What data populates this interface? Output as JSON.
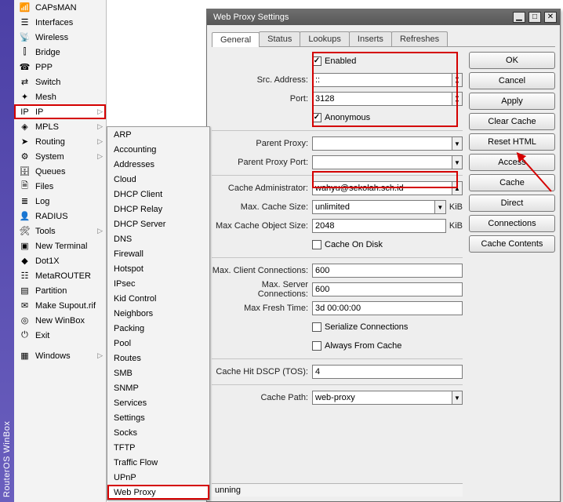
{
  "app": {
    "title": "RouterOS WinBox"
  },
  "nav": {
    "items": [
      {
        "label": "CAPsMAN",
        "icon": "ap-icon"
      },
      {
        "label": "Interfaces",
        "icon": "interfaces-icon"
      },
      {
        "label": "Wireless",
        "icon": "wireless-icon"
      },
      {
        "label": "Bridge",
        "icon": "bridge-icon"
      },
      {
        "label": "PPP",
        "icon": "ppp-icon"
      },
      {
        "label": "Switch",
        "icon": "switch-icon"
      },
      {
        "label": "Mesh",
        "icon": "mesh-icon"
      },
      {
        "label": "IP",
        "icon": "ip-icon",
        "arrow": true,
        "highlight": true
      },
      {
        "label": "MPLS",
        "icon": "mpls-icon",
        "arrow": true
      },
      {
        "label": "Routing",
        "icon": "routing-icon",
        "arrow": true
      },
      {
        "label": "System",
        "icon": "system-icon",
        "arrow": true
      },
      {
        "label": "Queues",
        "icon": "queues-icon"
      },
      {
        "label": "Files",
        "icon": "files-icon"
      },
      {
        "label": "Log",
        "icon": "log-icon"
      },
      {
        "label": "RADIUS",
        "icon": "radius-icon"
      },
      {
        "label": "Tools",
        "icon": "tools-icon",
        "arrow": true
      },
      {
        "label": "New Terminal",
        "icon": "terminal-icon"
      },
      {
        "label": "Dot1X",
        "icon": "dot1x-icon"
      },
      {
        "label": "MetaROUTER",
        "icon": "metarouter-icon"
      },
      {
        "label": "Partition",
        "icon": "partition-icon"
      },
      {
        "label": "Make Supout.rif",
        "icon": "supout-icon"
      },
      {
        "label": "New WinBox",
        "icon": "winbox-icon"
      },
      {
        "label": "Exit",
        "icon": "exit-icon"
      }
    ],
    "windows_label": "Windows"
  },
  "submenu": {
    "items": [
      "ARP",
      "Accounting",
      "Addresses",
      "Cloud",
      "DHCP Client",
      "DHCP Relay",
      "DHCP Server",
      "DNS",
      "Firewall",
      "Hotspot",
      "IPsec",
      "Kid Control",
      "Neighbors",
      "Packing",
      "Pool",
      "Routes",
      "SMB",
      "SNMP",
      "Services",
      "Settings",
      "Socks",
      "TFTP",
      "Traffic Flow",
      "UPnP",
      "Web Proxy"
    ],
    "highlight_index": 24
  },
  "dialog": {
    "title": "Web Proxy Settings",
    "tabs": [
      "General",
      "Status",
      "Lookups",
      "Inserts",
      "Refreshes"
    ],
    "active_tab": 0,
    "buttons": [
      "OK",
      "Cancel",
      "Apply",
      "Clear Cache",
      "Reset HTML",
      "Access",
      "Cache",
      "Direct",
      "Connections",
      "Cache Contents"
    ],
    "form": {
      "enabled_label": "Enabled",
      "enabled": true,
      "src_address_label": "Src. Address:",
      "src_address": "::",
      "port_label": "Port:",
      "port": "3128",
      "anonymous_label": "Anonymous",
      "anonymous": true,
      "parent_proxy_label": "Parent Proxy:",
      "parent_proxy": "",
      "parent_proxy_port_label": "Parent Proxy Port:",
      "parent_proxy_port": "",
      "cache_admin_label": "Cache Administrator:",
      "cache_admin": "wahyu@sekolah.sch.id",
      "max_cache_size_label": "Max. Cache Size:",
      "max_cache_size": "unlimited",
      "max_cache_size_unit": "KiB",
      "max_cache_obj_label": "Max Cache Object Size:",
      "max_cache_obj": "2048",
      "max_cache_obj_unit": "KiB",
      "cache_on_disk_label": "Cache On Disk",
      "cache_on_disk": false,
      "max_client_conn_label": "Max. Client Connections:",
      "max_client_conn": "600",
      "max_server_conn_label": "Max. Server Connections:",
      "max_server_conn": "600",
      "max_fresh_time_label": "Max Fresh Time:",
      "max_fresh_time": "3d 00:00:00",
      "serialize_label": "Serialize Connections",
      "serialize": false,
      "always_from_cache_label": "Always From Cache",
      "always_from_cache": false,
      "cache_hit_dscp_label": "Cache Hit DSCP (TOS):",
      "cache_hit_dscp": "4",
      "cache_path_label": "Cache Path:",
      "cache_path": "web-proxy"
    },
    "status": "unning"
  },
  "colors": {
    "highlight": "#d40000",
    "title_bar": "#575757"
  }
}
